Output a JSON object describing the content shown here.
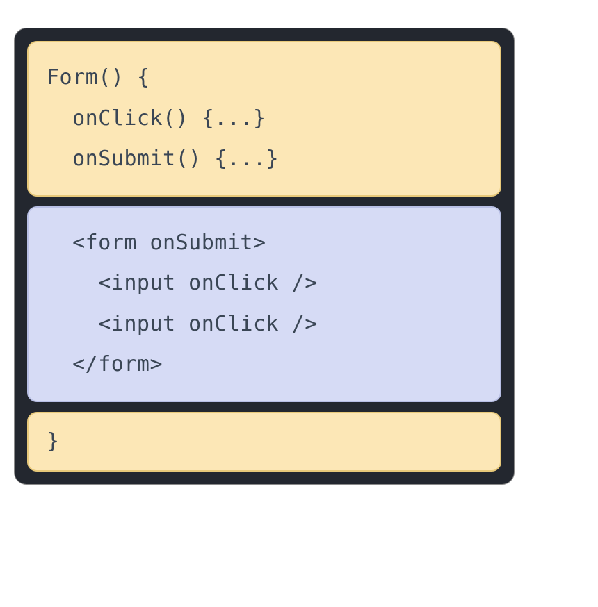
{
  "blocks": {
    "top": {
      "line1": "Form() {",
      "line2": "  onClick() {...}",
      "line3": "  onSubmit() {...}"
    },
    "middle": {
      "line1": "  <form onSubmit>",
      "line2": "    <input onClick />",
      "line3": "    <input onClick />",
      "line4": "  </form>"
    },
    "bottom": {
      "line1": "}"
    }
  }
}
